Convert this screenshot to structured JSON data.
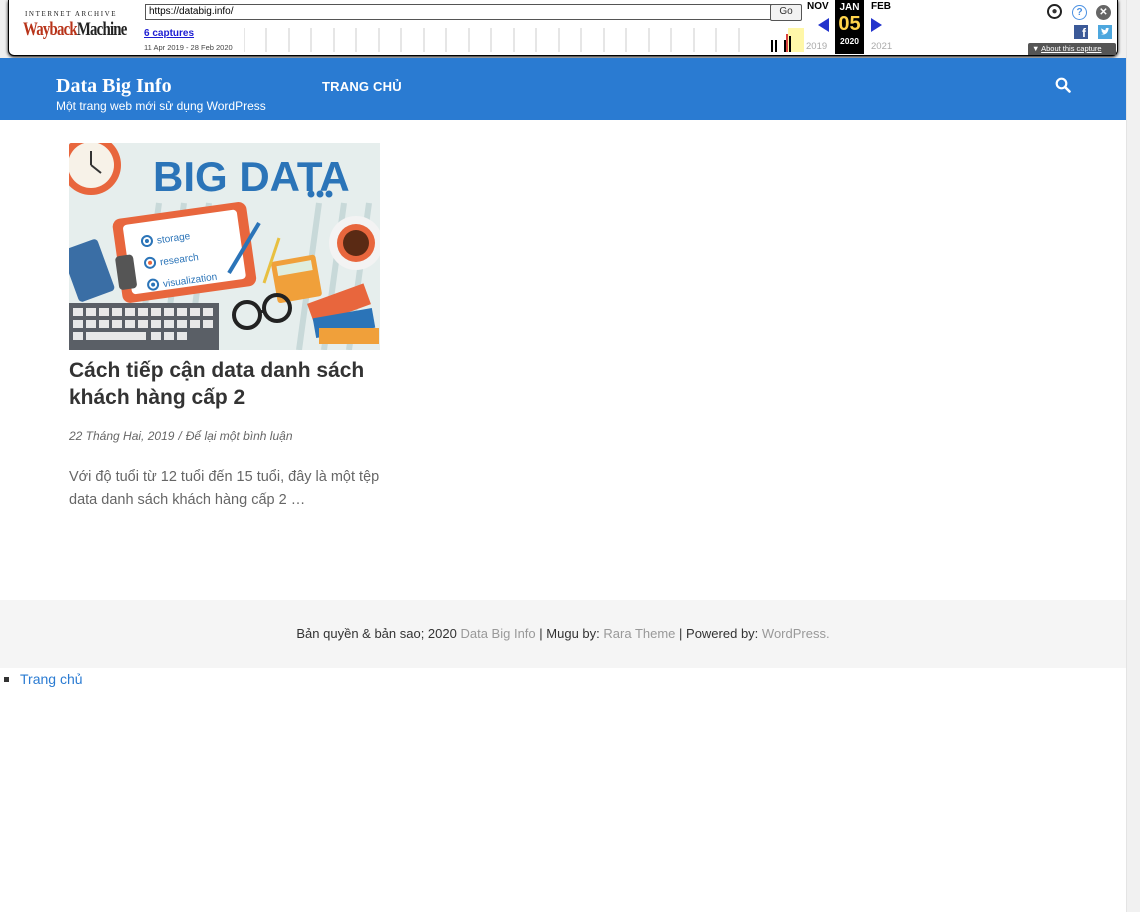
{
  "wayback": {
    "logo_top": "INTERNET ARCHIVE",
    "logo_way": "Wayback",
    "logo_machine": "Machine",
    "url_value": "https://databig.info/",
    "go_label": "Go",
    "captures_link": "6 captures",
    "date_range": "11 Apr 2019 - 28 Feb 2020",
    "prev_month": "NOV",
    "cur_month": "JAN",
    "next_month": "FEB",
    "cur_day": "05",
    "prev_year": "2019",
    "cur_year": "2020",
    "next_year": "2021",
    "about_label": "About this capture",
    "accent": "#2233cc"
  },
  "site": {
    "title": "Data Big Info",
    "description": "Một trang web mới sử dụng WordPress",
    "nav": [
      {
        "label": "TRANG CHỦ"
      }
    ],
    "header_color": "#2a7bd2"
  },
  "post": {
    "image_text": {
      "headline": "BIG DATA",
      "item1": "storage",
      "item2": "research",
      "item3": "visualization"
    },
    "title": "Cách tiếp cận data danh sách khách hàng cấp 2",
    "date": "22 Tháng Hai, 2019",
    "meta_sep": "/",
    "comments": "Để lại một bình luận",
    "excerpt": "Với độ tuổi từ 12 tuổi đến 15 tuổi, đây là một tệp data danh sách khách hàng cấp 2 …"
  },
  "footer": {
    "prefix": "Bản quyền & bản sao; 2020",
    "site_link": "Data Big Info",
    "sep": "|",
    "theme_prefix": "Mugu by:",
    "theme_link": "Rara Theme",
    "powered_prefix": "| Powered by:",
    "powered_link": "WordPress."
  },
  "bottom_menu": [
    {
      "label": "Trang chủ"
    }
  ]
}
